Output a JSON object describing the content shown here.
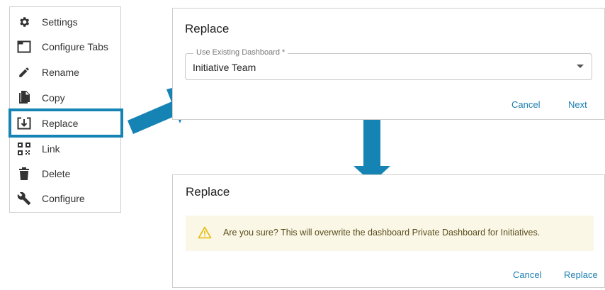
{
  "menu": {
    "items": [
      {
        "label": "Settings",
        "icon": "gear-icon"
      },
      {
        "label": "Configure Tabs",
        "icon": "tabs-icon"
      },
      {
        "label": "Rename",
        "icon": "pencil-icon"
      },
      {
        "label": "Copy",
        "icon": "copy-icon"
      },
      {
        "label": "Replace",
        "icon": "replace-icon"
      },
      {
        "label": "Link",
        "icon": "qr-code-icon"
      },
      {
        "label": "Delete",
        "icon": "trash-icon"
      },
      {
        "label": "Configure",
        "icon": "wrench-icon"
      }
    ],
    "highlighted_item": "Replace"
  },
  "dialog_select": {
    "title": "Replace",
    "field_label": "Use Existing Dashboard *",
    "field_value": "Initiative Team",
    "cancel_label": "Cancel",
    "next_label": "Next"
  },
  "dialog_confirm": {
    "title": "Replace",
    "warning_text": "Are you sure? This will overwrite the dashboard Private Dashboard for Initiatives.",
    "cancel_label": "Cancel",
    "replace_label": "Replace"
  },
  "colors": {
    "accent": "#1683b5",
    "link": "#1a7db0",
    "warning_bg": "#faf7e6",
    "warning_icon": "#e6b800"
  }
}
